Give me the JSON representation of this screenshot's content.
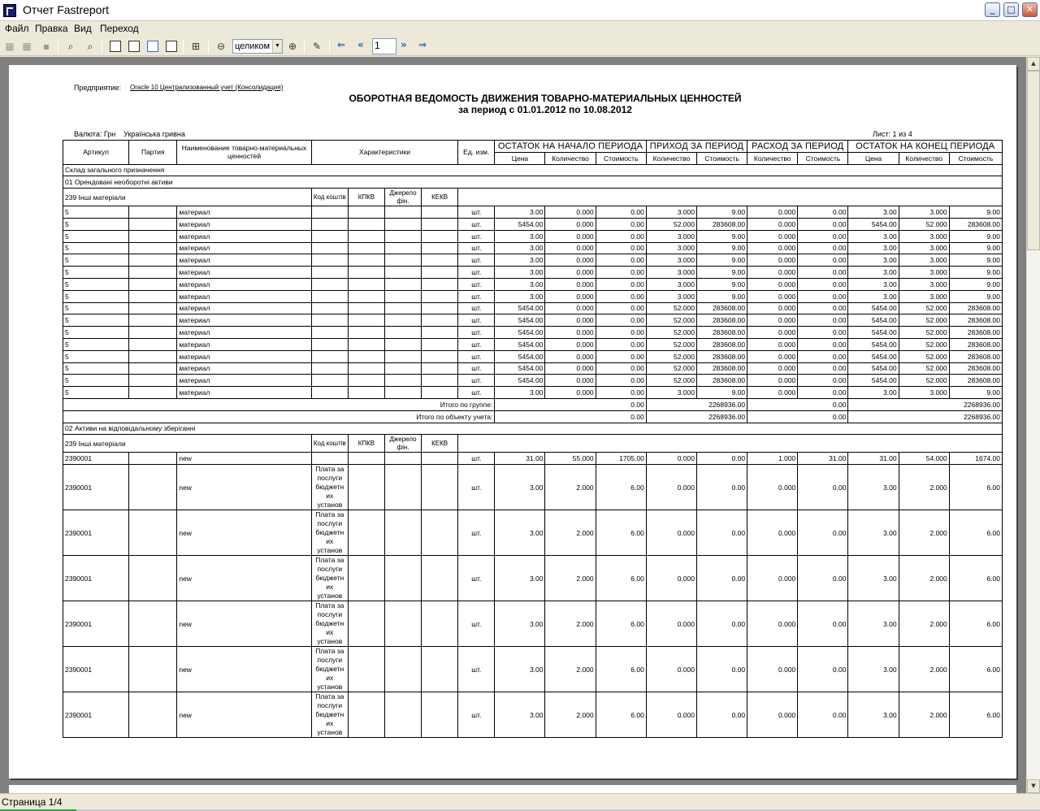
{
  "window": {
    "title": "Отчет Fastreport",
    "minimize": "_",
    "maximize": "□",
    "close": "✕"
  },
  "menu": [
    "Файл",
    "Правка",
    "Вид",
    "Переход"
  ],
  "toolbar": {
    "zoom_value": "целиком",
    "page_value": "1"
  },
  "status": {
    "text": "Страница 1/4"
  },
  "report": {
    "enterprise_label": "Предприятие:",
    "enterprise_value": "Oracle 10 Централизованный учет (Консолидация)",
    "title_line1": "ОБОРОТНАЯ ВЕДОМОСТЬ ДВИЖЕНИЯ ТОВАРНО-МАТЕРИАЛЬНЫХ ЦЕННОСТЕЙ",
    "title_line2": "за период с 01.01.2012 по 10.08.2012",
    "currency": "Валюта: Грн    Українська гривна",
    "sheet": "Лист: 1 из 4",
    "headers": {
      "article": "Артикул",
      "batch": "Партия",
      "name": "Наименование товарно-материальных ценностей",
      "chars": "Характеристики",
      "unit": "Ед. изм.",
      "open": "ОСТАТОК НА НАЧАЛО ПЕРИОДА",
      "income": "ПРИХОД ЗА ПЕРИОД",
      "expense": "РАСХОД ЗА ПЕРИОД",
      "close": "ОСТАТОК НА КОНЕЦ ПЕРИОДА",
      "price": "Цена",
      "qty": "Количество",
      "cost": "Стоимость"
    },
    "warehouse": "Склад загального призначення",
    "sub_headers": {
      "kod": "Код коштів",
      "kpkv": "КПКВ",
      "dzherelo": "Джерело фін.",
      "kekv": "КЕКВ"
    },
    "group1": {
      "title": "01 Орендовані необоротні активи",
      "account": "239 Інші матеріали",
      "rows": [
        [
          "5",
          "материал",
          "шт.",
          "3.00",
          "0.000",
          "0.00",
          "3.000",
          "9.00",
          "0.000",
          "0.00",
          "3.00",
          "3.000",
          "9.00"
        ],
        [
          "5",
          "материал",
          "шт.",
          "5454.00",
          "0.000",
          "0.00",
          "52.000",
          "283608.00",
          "0.000",
          "0.00",
          "5454.00",
          "52.000",
          "283608.00"
        ],
        [
          "5",
          "материал",
          "шт.",
          "3.00",
          "0.000",
          "0.00",
          "3.000",
          "9.00",
          "0.000",
          "0.00",
          "3.00",
          "3.000",
          "9.00"
        ],
        [
          "5",
          "материал",
          "шт.",
          "3.00",
          "0.000",
          "0.00",
          "3.000",
          "9.00",
          "0.000",
          "0.00",
          "3.00",
          "3.000",
          "9.00"
        ],
        [
          "5",
          "материал",
          "шт.",
          "3.00",
          "0.000",
          "0.00",
          "3.000",
          "9.00",
          "0.000",
          "0.00",
          "3.00",
          "3.000",
          "9.00"
        ],
        [
          "5",
          "материал",
          "шт.",
          "3.00",
          "0.000",
          "0.00",
          "3.000",
          "9.00",
          "0.000",
          "0.00",
          "3.00",
          "3.000",
          "9.00"
        ],
        [
          "5",
          "материал",
          "шт.",
          "3.00",
          "0.000",
          "0.00",
          "3.000",
          "9.00",
          "0.000",
          "0.00",
          "3.00",
          "3.000",
          "9.00"
        ],
        [
          "5",
          "материал",
          "шт.",
          "3.00",
          "0.000",
          "0.00",
          "3.000",
          "9.00",
          "0.000",
          "0.00",
          "3.00",
          "3.000",
          "9.00"
        ],
        [
          "5",
          "материал",
          "шт.",
          "5454.00",
          "0.000",
          "0.00",
          "52.000",
          "283608.00",
          "0.000",
          "0.00",
          "5454.00",
          "52.000",
          "283608.00"
        ],
        [
          "5",
          "материал",
          "шт.",
          "5454.00",
          "0.000",
          "0.00",
          "52.000",
          "283608.00",
          "0.000",
          "0.00",
          "5454.00",
          "52.000",
          "283608.00"
        ],
        [
          "5",
          "материал",
          "шт.",
          "5454.00",
          "0.000",
          "0.00",
          "52.000",
          "283608.00",
          "0.000",
          "0.00",
          "5454.00",
          "52.000",
          "283608.00"
        ],
        [
          "5",
          "материал",
          "шт.",
          "5454.00",
          "0.000",
          "0.00",
          "52.000",
          "283608.00",
          "0.000",
          "0.00",
          "5454.00",
          "52.000",
          "283608.00"
        ],
        [
          "5",
          "материал",
          "шт.",
          "5454.00",
          "0.000",
          "0.00",
          "52.000",
          "283608.00",
          "0.000",
          "0.00",
          "5454.00",
          "52.000",
          "283608.00"
        ],
        [
          "5",
          "материал",
          "шт.",
          "5454.00",
          "0.000",
          "0.00",
          "52.000",
          "283608.00",
          "0.000",
          "0.00",
          "5454.00",
          "52.000",
          "283608.00"
        ],
        [
          "5",
          "материал",
          "шт.",
          "5454.00",
          "0.000",
          "0.00",
          "52.000",
          "283608.00",
          "0.000",
          "0.00",
          "5454.00",
          "52.000",
          "283608.00"
        ],
        [
          "5",
          "материал",
          "шт.",
          "3.00",
          "0.000",
          "0.00",
          "3.000",
          "9.00",
          "0.000",
          "0.00",
          "3.00",
          "3.000",
          "9.00"
        ]
      ],
      "total_group_label": "Итого по группе:",
      "total_group": [
        "0.00",
        "2268936.00",
        "0.00",
        "2268936.00"
      ],
      "total_object_label": "Итого по объекту учета:",
      "total_object": [
        "0.00",
        "2268936.00",
        "0.00",
        "2268936.00"
      ]
    },
    "group2": {
      "title": "02 Активи на відповідальному зберіганні",
      "account": "239 Інші матеріали",
      "first_row": [
        "2390001",
        "new",
        "шт.",
        "31.00",
        "55.000",
        "1705.00",
        "0.000",
        "0.00",
        "1.000",
        "31.00",
        "31.00",
        "54.000",
        "1674.00"
      ],
      "char_text": "Плата за послуги бюджетн их установ",
      "rows": [
        [
          "2390001",
          "new",
          "шт.",
          "3.00",
          "2.000",
          "6.00",
          "0.000",
          "0.00",
          "0.000",
          "0.00",
          "3.00",
          "2.000",
          "6.00"
        ],
        [
          "2390001",
          "new",
          "шт.",
          "3.00",
          "2.000",
          "6.00",
          "0.000",
          "0.00",
          "0.000",
          "0.00",
          "3.00",
          "2.000",
          "6.00"
        ],
        [
          "2390001",
          "new",
          "шт.",
          "3.00",
          "2.000",
          "6.00",
          "0.000",
          "0.00",
          "0.000",
          "0.00",
          "3.00",
          "2.000",
          "6.00"
        ],
        [
          "2390001",
          "new",
          "шт.",
          "3.00",
          "2.000",
          "6.00",
          "0.000",
          "0.00",
          "0.000",
          "0.00",
          "3.00",
          "2.000",
          "6.00"
        ],
        [
          "2390001",
          "new",
          "шт.",
          "3.00",
          "2.000",
          "6.00",
          "0.000",
          "0.00",
          "0.000",
          "0.00",
          "3.00",
          "2.000",
          "6.00"
        ],
        [
          "2390001",
          "new",
          "шт.",
          "3.00",
          "2.000",
          "6.00",
          "0.000",
          "0.00",
          "0.000",
          "0.00",
          "3.00",
          "2.000",
          "6.00"
        ]
      ]
    }
  }
}
